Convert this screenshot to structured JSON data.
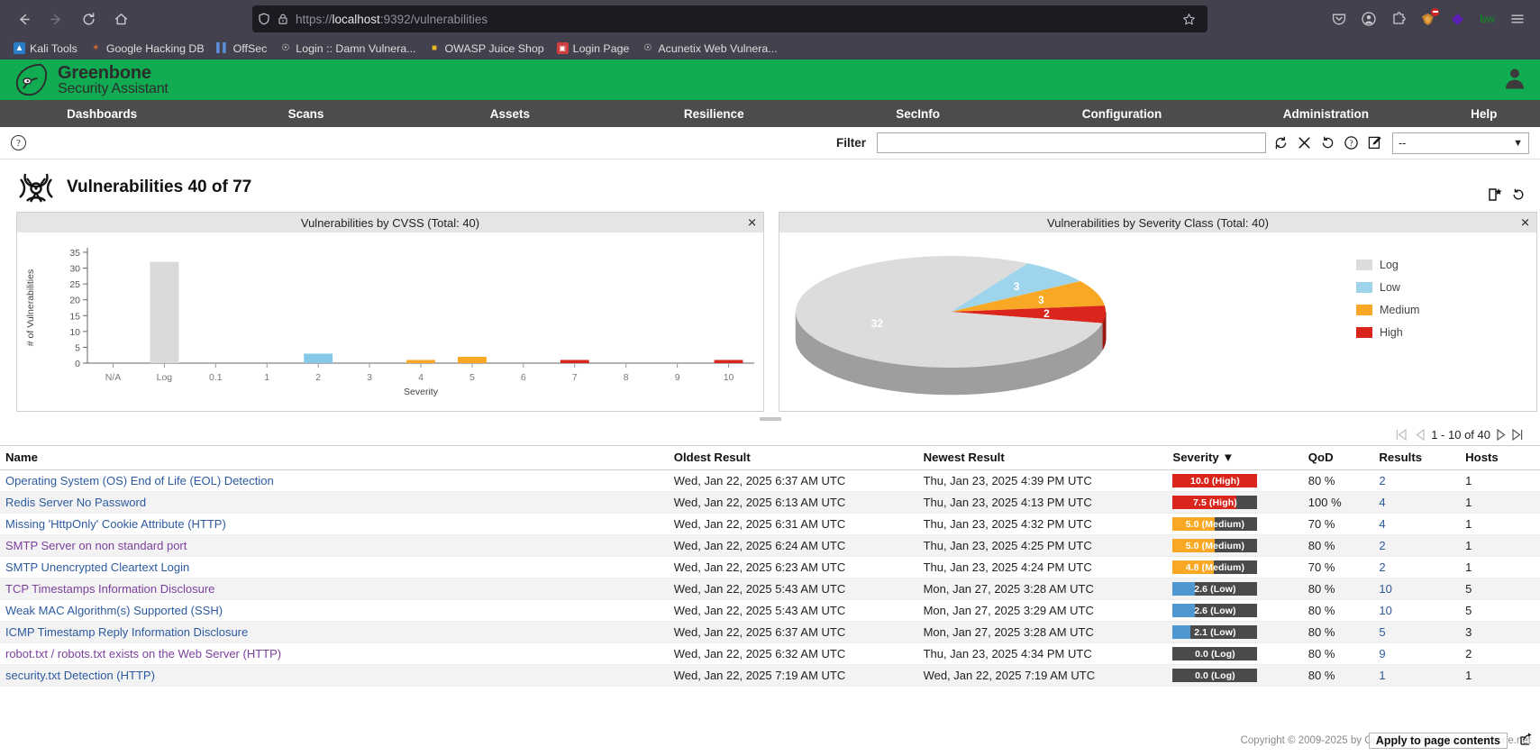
{
  "browser": {
    "back_icon": "back-arrow-icon",
    "forward_icon": "forward-arrow-icon",
    "reload_icon": "reload-icon",
    "home_icon": "home-icon",
    "url_protocol": "https://",
    "url_host": "localhost",
    "url_rest": ":9392/vulnerabilities",
    "url_full": "https://localhost:9392/vulnerabilities",
    "shield_icon": "shield-icon",
    "lock_warning_icon": "lock-warning-icon",
    "star_icon": "bookmark-star-icon",
    "right_icons": [
      {
        "name": "pocket-icon",
        "glyph": "⌵"
      },
      {
        "name": "account-icon",
        "glyph": "●"
      },
      {
        "name": "extensions-icon",
        "glyph": "⬚"
      },
      {
        "name": "ublock-origin-icon",
        "glyph": "■"
      },
      {
        "name": "purple-diamond-extension-icon",
        "glyph": "◆"
      },
      {
        "name": "bitwarden-icon",
        "glyph": "bw"
      },
      {
        "name": "hamburger-menu-icon",
        "glyph": "☰"
      }
    ],
    "bookmarks": [
      {
        "label": "Kali Tools",
        "icon": "kali-dragon-icon",
        "color": "#2a7dc9",
        "glyph": "◓"
      },
      {
        "label": "Google Hacking DB",
        "icon": "exploitdb-icon",
        "color": "#c0392b",
        "glyph": "✶"
      },
      {
        "label": "OffSec",
        "icon": "offsec-icon",
        "color": "#4a7fc1",
        "glyph": "‖"
      },
      {
        "label": "Login :: Damn Vulnera...",
        "icon": "globe-icon",
        "color": "#dddddd",
        "glyph": "⊕"
      },
      {
        "label": "OWASP Juice Shop",
        "icon": "juice-shop-icon",
        "color": "#e8b923",
        "glyph": "▮"
      },
      {
        "label": "Login Page",
        "icon": "login-page-icon",
        "color": "#d94f4f",
        "glyph": "▣"
      },
      {
        "label": "Acunetix Web Vulnera...",
        "icon": "globe-icon",
        "color": "#dddddd",
        "glyph": "⊕"
      }
    ]
  },
  "app": {
    "brand_line1": "Greenbone",
    "brand_line2": "Security Assistant",
    "brand_color": "#11ab51",
    "logo_icon": "greenbone-leaf-logo",
    "user_icon": "user-account-icon",
    "menu": [
      {
        "label": "Dashboards",
        "name": "nav-dashboards"
      },
      {
        "label": "Scans",
        "name": "nav-scans"
      },
      {
        "label": "Assets",
        "name": "nav-assets"
      },
      {
        "label": "Resilience",
        "name": "nav-resilience"
      },
      {
        "label": "SecInfo",
        "name": "nav-secinfo"
      },
      {
        "label": "Configuration",
        "name": "nav-configuration"
      },
      {
        "label": "Administration",
        "name": "nav-administration"
      },
      {
        "label": "Help",
        "name": "nav-help"
      }
    ]
  },
  "filter": {
    "help_icon": "help-circle-icon",
    "label": "Filter",
    "value": "",
    "placeholder": "",
    "icons": [
      {
        "name": "update-filter-icon",
        "glyph": "↻"
      },
      {
        "name": "reset-filter-icon",
        "glyph": "✕"
      },
      {
        "name": "revert-filter-icon",
        "glyph": "↺"
      },
      {
        "name": "filter-help-icon",
        "glyph": "?"
      },
      {
        "name": "edit-filter-icon",
        "glyph": "✎"
      }
    ],
    "select_value": "--",
    "select_caret": "▼"
  },
  "page": {
    "title": "Vulnerabilities 40 of 77",
    "biohazard_icon": "biohazard-icon",
    "new_filter_icon": "new-filter-icon",
    "refresh_icon": "refresh-icon"
  },
  "dashboard": {
    "cvss_panel_title": "Vulnerabilities by CVSS (Total: 40)",
    "severity_panel_title": "Vulnerabilities by Severity Class (Total: 40)",
    "close_glyph": "✕"
  },
  "chart_data": [
    {
      "type": "bar",
      "title": "Vulnerabilities by CVSS (Total: 40)",
      "xlabel": "Severity",
      "ylabel": "# of Vulnerabilities",
      "categories": [
        "N/A",
        "Log",
        "0.1",
        "1",
        "2",
        "3",
        "4",
        "5",
        "6",
        "7",
        "8",
        "9",
        "10"
      ],
      "values": [
        0,
        32,
        0,
        0,
        3,
        0,
        1,
        2,
        0,
        1,
        0,
        0,
        1
      ],
      "colors": [
        "#d9d9d9",
        "#d9d9d9",
        "#85c8e8",
        "#85c8e8",
        "#85c8e8",
        "#85c8e8",
        "#f9a825",
        "#f9a825",
        "#f9a825",
        "#d9251c",
        "#d9251c",
        "#d9251c",
        "#d9251c"
      ],
      "ylim": [
        0,
        35
      ],
      "yticks": [
        0,
        5,
        10,
        15,
        20,
        25,
        30,
        35
      ],
      "grid": false
    },
    {
      "type": "pie",
      "title": "Vulnerabilities by Severity Class (Total: 40)",
      "labels": [
        "Log",
        "Low",
        "Medium",
        "High"
      ],
      "values": [
        32,
        3,
        3,
        2
      ],
      "colors": [
        "#dcdcdc",
        "#9ed5ec",
        "#f9a825",
        "#d9251c"
      ],
      "legend_position": "right",
      "three_d": true
    }
  ],
  "pagination": {
    "first_icon": "first-page-icon",
    "prev_icon": "previous-page-icon",
    "text": "1 - 10 of 40",
    "next_icon": "next-page-icon",
    "last_icon": "last-page-icon"
  },
  "table": {
    "columns": [
      "Name",
      "Oldest Result",
      "Newest Result",
      "Severity ▼",
      "QoD",
      "Results",
      "Hosts"
    ],
    "rows": [
      {
        "name": "Operating System (OS) End of Life (EOL) Detection",
        "visited": false,
        "oldest": "Wed, Jan 22, 2025 6:37 AM UTC",
        "newest": "Thu, Jan 23, 2025 4:39 PM UTC",
        "severity_label": "10.0 (High)",
        "severity_value": 10.0,
        "severity_color": "#d9251c",
        "qod": "80 %",
        "results": "2",
        "hosts": "1"
      },
      {
        "name": "Redis Server No Password",
        "visited": false,
        "oldest": "Wed, Jan 22, 2025 6:13 AM UTC",
        "newest": "Thu, Jan 23, 2025 4:13 PM UTC",
        "severity_label": "7.5 (High)",
        "severity_value": 7.5,
        "severity_color": "#d9251c",
        "qod": "100 %",
        "results": "4",
        "hosts": "1"
      },
      {
        "name": "Missing 'HttpOnly' Cookie Attribute (HTTP)",
        "visited": false,
        "oldest": "Wed, Jan 22, 2025 6:31 AM UTC",
        "newest": "Thu, Jan 23, 2025 4:32 PM UTC",
        "severity_label": "5.0 (Medium)",
        "severity_value": 5.0,
        "severity_color": "#f9a825",
        "qod": "70 %",
        "results": "4",
        "hosts": "1"
      },
      {
        "name": "SMTP Server on non standard port",
        "visited": true,
        "oldest": "Wed, Jan 22, 2025 6:24 AM UTC",
        "newest": "Thu, Jan 23, 2025 4:25 PM UTC",
        "severity_label": "5.0 (Medium)",
        "severity_value": 5.0,
        "severity_color": "#f9a825",
        "qod": "80 %",
        "results": "2",
        "hosts": "1"
      },
      {
        "name": "SMTP Unencrypted Cleartext Login",
        "visited": false,
        "oldest": "Wed, Jan 22, 2025 6:23 AM UTC",
        "newest": "Thu, Jan 23, 2025 4:24 PM UTC",
        "severity_label": "4.8 (Medium)",
        "severity_value": 4.8,
        "severity_color": "#f9a825",
        "qod": "70 %",
        "results": "2",
        "hosts": "1"
      },
      {
        "name": "TCP Timestamps Information Disclosure",
        "visited": true,
        "oldest": "Wed, Jan 22, 2025 5:43 AM UTC",
        "newest": "Mon, Jan 27, 2025 3:28 AM UTC",
        "severity_label": "2.6 (Low)",
        "severity_value": 2.6,
        "severity_color": "#4e97d1",
        "qod": "80 %",
        "results": "10",
        "hosts": "5"
      },
      {
        "name": "Weak MAC Algorithm(s) Supported (SSH)",
        "visited": false,
        "oldest": "Wed, Jan 22, 2025 5:43 AM UTC",
        "newest": "Mon, Jan 27, 2025 3:29 AM UTC",
        "severity_label": "2.6 (Low)",
        "severity_value": 2.6,
        "severity_color": "#4e97d1",
        "qod": "80 %",
        "results": "10",
        "hosts": "5"
      },
      {
        "name": "ICMP Timestamp Reply Information Disclosure",
        "visited": false,
        "oldest": "Wed, Jan 22, 2025 6:37 AM UTC",
        "newest": "Mon, Jan 27, 2025 3:28 AM UTC",
        "severity_label": "2.1 (Low)",
        "severity_value": 2.1,
        "severity_color": "#4e97d1",
        "qod": "80 %",
        "results": "5",
        "hosts": "3"
      },
      {
        "name": "robot.txt / robots.txt exists on the Web Server (HTTP)",
        "visited": true,
        "oldest": "Wed, Jan 22, 2025 6:32 AM UTC",
        "newest": "Thu, Jan 23, 2025 4:34 PM UTC",
        "severity_label": "0.0 (Log)",
        "severity_value": 0.0,
        "severity_color": "#4a4a4a",
        "qod": "80 %",
        "results": "9",
        "hosts": "2"
      },
      {
        "name": "security.txt Detection (HTTP)",
        "visited": false,
        "oldest": "Wed, Jan 22, 2025 7:19 AM UTC",
        "newest": "Wed, Jan 22, 2025 7:19 AM UTC",
        "severity_label": "0.0 (Log)",
        "severity_value": 0.0,
        "severity_color": "#4a4a4a",
        "qod": "80 %",
        "results": "1",
        "hosts": "1"
      }
    ]
  },
  "footer": {
    "copyright": "Copyright © 2009-2025 by Greenbone AG, www.greenbone.net",
    "tooltip": "Apply to page contents",
    "ext_icon": "share-icon"
  }
}
